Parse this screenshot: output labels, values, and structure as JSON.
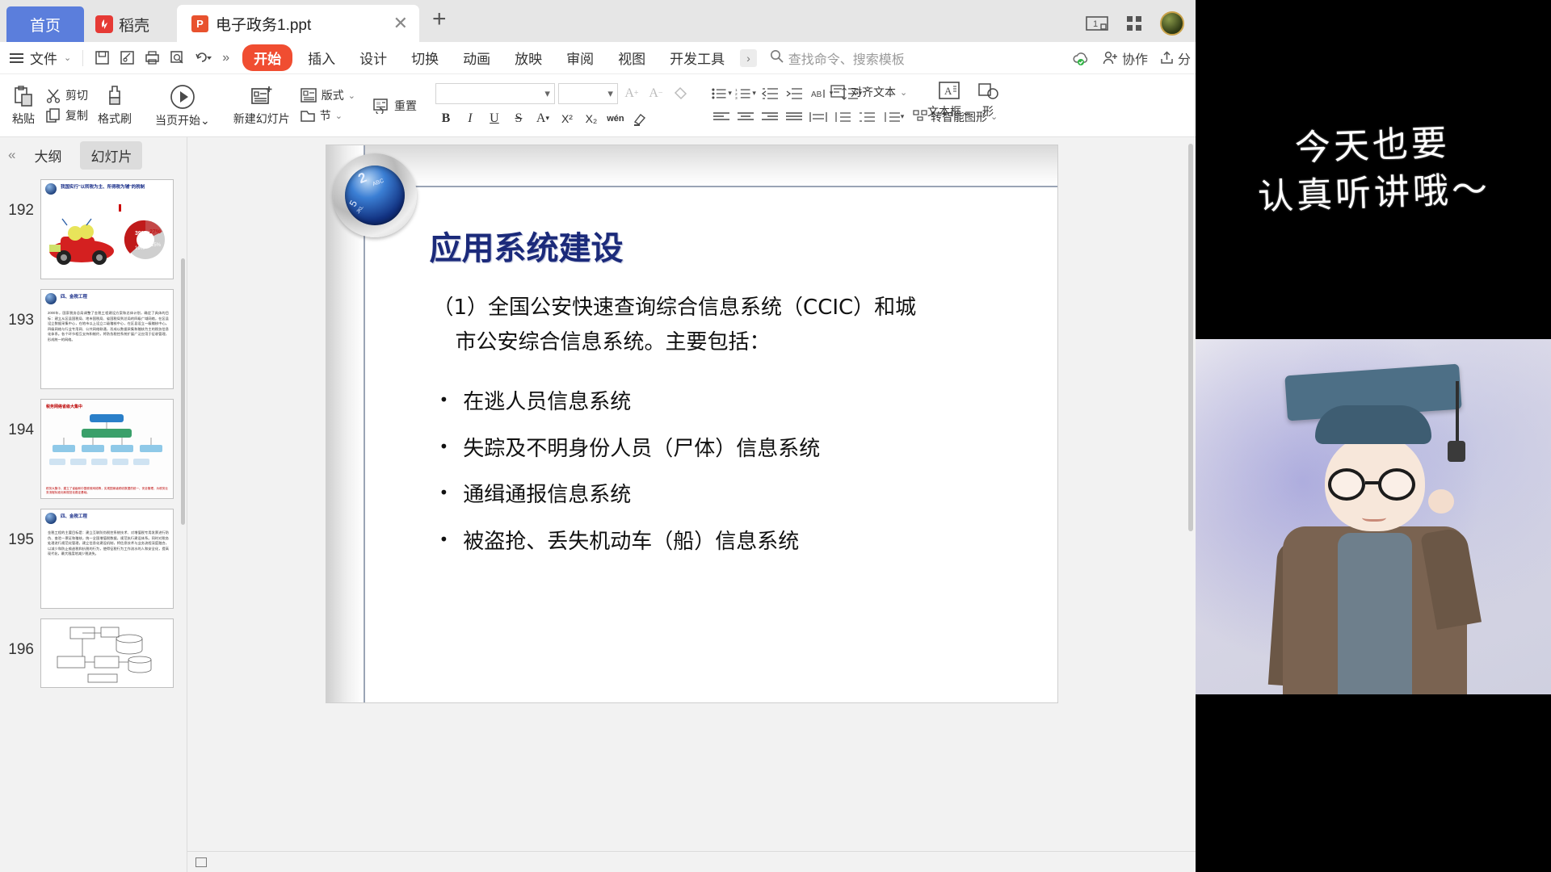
{
  "window": {
    "tabs": [
      {
        "label": "首页",
        "type": "home"
      },
      {
        "label": "稻壳",
        "type": "docer",
        "logo": "D"
      },
      {
        "label": "电子政务1.ppt",
        "type": "document",
        "icon": "P"
      }
    ],
    "new_tab_label": "+",
    "close_label": "✕",
    "right_icons": [
      "window-layout-icon",
      "grid-apps-icon",
      "user-avatar"
    ]
  },
  "menubar": {
    "file_label": "文件",
    "file_chevron": "⌄",
    "quick_icons": [
      "save-icon",
      "save-as-icon",
      "print-icon",
      "print-preview-icon",
      "undo-icon",
      "more-icon"
    ],
    "more_label": "»",
    "ribbon_tabs": [
      {
        "label": "开始",
        "active": true
      },
      {
        "label": "插入",
        "active": false
      },
      {
        "label": "设计",
        "active": false
      },
      {
        "label": "切换",
        "active": false
      },
      {
        "label": "动画",
        "active": false
      },
      {
        "label": "放映",
        "active": false
      },
      {
        "label": "审阅",
        "active": false
      },
      {
        "label": "视图",
        "active": false
      },
      {
        "label": "开发工具",
        "active": false
      }
    ],
    "overflow_label": "›",
    "search_placeholder": "查找命令、搜索模板",
    "right_items": [
      {
        "label": "",
        "icon": "cloud-sync-icon"
      },
      {
        "label": "协作",
        "icon": "collaborate-icon"
      },
      {
        "label": "分",
        "icon": "share-icon"
      }
    ]
  },
  "toolbar": {
    "paste_label": "粘贴",
    "paste_chevron": "⌄",
    "cut_label": "剪切",
    "copy_label": "复制",
    "format_painter_label": "格式刷",
    "start_from_current_label": "当页开始",
    "start_chevron": "⌄",
    "new_slide_label": "新建幻灯片",
    "layout_label": "版式",
    "layout_chevron": "⌄",
    "section_label": "节",
    "section_chevron": "⌄",
    "reset_label": "重置",
    "font_name": "",
    "font_size": "",
    "grow_font_label": "A",
    "shrink_font_label": "A",
    "clear_format_label": "clear-format-icon",
    "bold_label": "B",
    "italic_label": "I",
    "underline_label": "U",
    "strike_label": "S",
    "text_color_label": "A",
    "superscript_label": "X²",
    "subscript_label": "X₂",
    "pinyin_label": "wén",
    "highlight_label": "highlight-icon",
    "align_text_label": "对齐文本",
    "line_spacing_label": "line-spacing-icon",
    "smart_art_label": "转智能图形",
    "text_box_label": "文本框",
    "shape_label": "形"
  },
  "slide_panel": {
    "collapse_icon": "«",
    "tabs": [
      {
        "label": "大纲",
        "active": false
      },
      {
        "label": "幻灯片",
        "active": true
      }
    ],
    "slides": [
      {
        "number": "192",
        "title": "我国实行\"以转税为主、所得税为辅\"的税制",
        "body": "",
        "active": false
      },
      {
        "number": "193",
        "title": "四、金税工程",
        "body": "2000年，国家税务总局调整了金税工程建设方案和总体计划，确定了具体的目标：建立从区县国税局、地市国税局、省国税局到总局的四级广域网络，在区县设立数据采集中心，在地市以上设立二级稽核中心，在区县设立一级稽核中心。四级网络与行业专用网、公共网络联通，形成以数据采集和稽核为主的税务信息化体系。各个环节相互支持和制约，将防伪税控系统扩展广泛应用于征收管理，形成统一的网络。",
        "active": false
      },
      {
        "number": "194",
        "title": "税务网络省级大集中",
        "body": "",
        "active": false
      },
      {
        "number": "195",
        "title": "四、金税工程",
        "body": "金税工程的主要目标是：建立互联防伪税控系统技术、对增值税专用发票进行防伪、查验一票证和稽核，统一全国增值税数据，规范执行建设体系。同时对税务处理进行规范化管理，建立信息化建设机制，将信息技术与业务流程深度融合，以减少和防止偷逃税和抗税的行为，使得征税行为工作流水的人和安全化，提高现代化，最大限度地减少税流失。",
        "active": false
      },
      {
        "number": "196",
        "title": "",
        "body": "",
        "active": false
      }
    ]
  },
  "slide": {
    "title": "应用系统建设",
    "paragraph_line1": "（1）全国公安快速查询综合信息系统（CCIC）和城",
    "paragraph_line2": "市公安综合信息系统。主要包括：",
    "bullets": [
      "在逃人员信息系统",
      "失踪及不明身份人员（尸体）信息系统",
      "通缉通报信息系统",
      "被盗抢、丢失机动车（船）信息系统"
    ],
    "orb_labels": {
      "num2": "2",
      "abc": "ABC",
      "num5": "5",
      "jkl": "JKL"
    },
    "colors": {
      "title": "#1b2a7a",
      "body": "#111111",
      "accent_red": "#f04d31"
    }
  },
  "video_overlay": {
    "caption_line1": "今天也要",
    "caption_line2": "认真听讲哦～"
  }
}
